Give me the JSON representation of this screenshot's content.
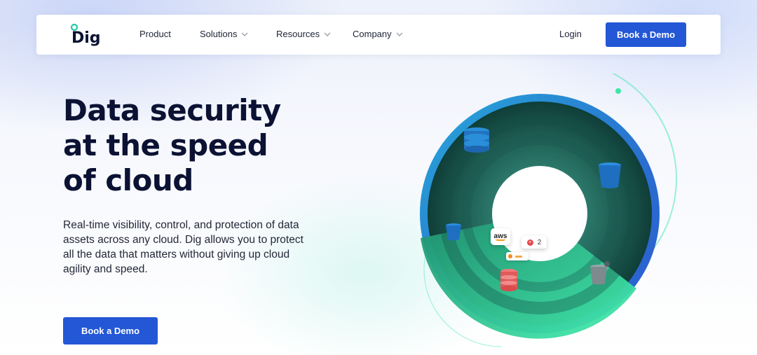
{
  "brand": {
    "name": "Dig"
  },
  "nav": {
    "items": [
      {
        "label": "Product",
        "has_dropdown": false
      },
      {
        "label": "Solutions",
        "has_dropdown": true
      },
      {
        "label": "Resources",
        "has_dropdown": true
      },
      {
        "label": "Company",
        "has_dropdown": true
      }
    ],
    "login_label": "Login",
    "cta_label": "Book a Demo"
  },
  "hero": {
    "title_lines": [
      "Data security",
      "at the speed",
      "of cloud"
    ],
    "description": "Real-time visibility, control, and protection of data assets across any cloud. Dig allows you to protect all the data that matters without giving up cloud agility and speed.",
    "cta_label": "Book a Demo"
  },
  "visual": {
    "aws_label": "aws",
    "alert_count": "2",
    "icons": [
      "database-stack-icon",
      "bucket-icon",
      "bucket-icon",
      "database-red-icon",
      "bucket-icon"
    ]
  },
  "colors": {
    "primary": "#2357d6",
    "heading": "#0b1233",
    "ring_outer": "#2a7fd0",
    "ring_dark": "#0f4a3f",
    "ring_green": "#3de6a6",
    "accent_line": "#5be8c0"
  }
}
